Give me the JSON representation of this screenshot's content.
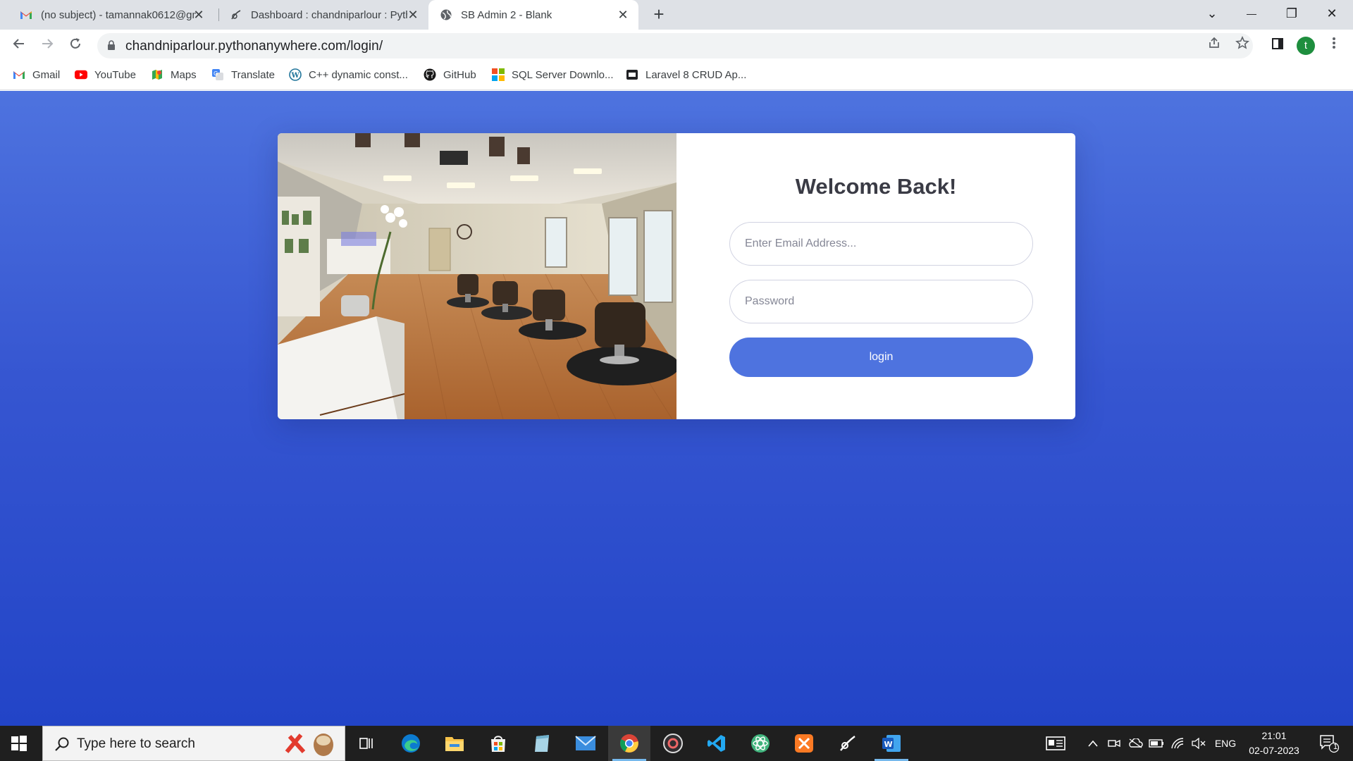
{
  "browser": {
    "tabs": [
      {
        "title": "(no subject) - tamannak0612@gm",
        "icon": "gmail-icon",
        "active": false
      },
      {
        "title": "Dashboard : chandniparlour : Pyth",
        "icon": "pythonanywhere-icon",
        "active": false
      },
      {
        "title": "SB Admin 2 - Blank",
        "icon": "globe-icon",
        "active": true
      }
    ],
    "new_tab_symbol": "+",
    "window_controls": {
      "minimize": "—",
      "restore": "❐",
      "close": "✕",
      "tab_search": "⌄"
    },
    "url": "chandniparlour.pythonanywhere.com/login/",
    "profile_initial": "t",
    "bookmarks": [
      {
        "label": "Gmail",
        "icon": "gmail-icon"
      },
      {
        "label": "YouTube",
        "icon": "youtube-icon"
      },
      {
        "label": "Maps",
        "icon": "maps-icon"
      },
      {
        "label": "Translate",
        "icon": "translate-icon"
      },
      {
        "label": "C++ dynamic const...",
        "icon": "wordpress-icon"
      },
      {
        "label": "GitHub",
        "icon": "github-icon"
      },
      {
        "label": "SQL Server Downlo...",
        "icon": "microsoft-icon"
      },
      {
        "label": "Laravel 8 CRUD Ap...",
        "icon": "page-icon"
      }
    ]
  },
  "login": {
    "heading": "Welcome Back!",
    "email_placeholder": "Enter Email Address...",
    "password_placeholder": "Password",
    "submit_label": "login",
    "image_alt": "salon-interior-photo"
  },
  "taskbar": {
    "search_placeholder": "Type here to search",
    "apps": [
      "task-view",
      "edge",
      "file-explorer",
      "microsoft-store",
      "notepad",
      "mail",
      "chrome",
      "obs",
      "vscode",
      "atom",
      "xampp",
      "pythonanywhere",
      "word"
    ],
    "language": "ENG",
    "time": "21:01",
    "date": "02-07-2023",
    "notification_count": "1"
  },
  "colors": {
    "primary": "#4e73df",
    "page_gradient_end": "#2244c7",
    "tab_strip": "#dee1e6"
  }
}
